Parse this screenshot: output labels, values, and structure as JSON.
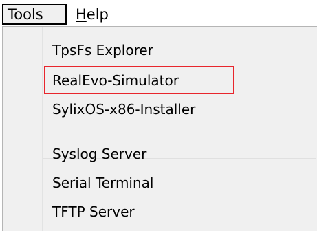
{
  "menubar": {
    "tools_label": "Tools",
    "help_label_mnemonic": "H",
    "help_label_rest": "elp"
  },
  "tools_menu": {
    "items": [
      {
        "label": "TpsFs Explorer"
      },
      {
        "label": "RealEvo-Simulator",
        "highlighted": true
      },
      {
        "label": "SylixOS-x86-Installer"
      },
      {
        "label": "Syslog Server"
      },
      {
        "label": "Serial Terminal"
      },
      {
        "label": "TFTP Server"
      }
    ]
  },
  "colors": {
    "highlight_border": "#e8262d",
    "menu_background": "#f0f0f0"
  }
}
